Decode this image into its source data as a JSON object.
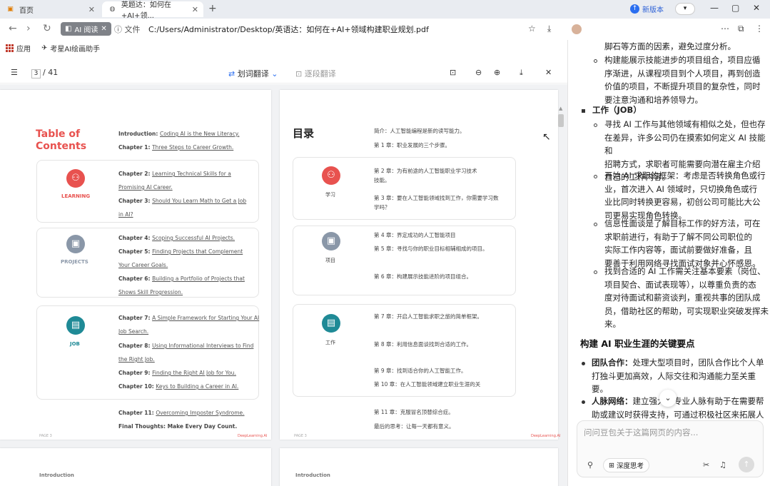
{
  "tabs": [
    {
      "label": "百页",
      "icon": "folder-icon"
    },
    {
      "label": "英题达：如何在+AI+领...",
      "icon": "globe-icon"
    }
  ],
  "chrome": {
    "new_version": "新版本",
    "profile": "▾"
  },
  "toolbar": {
    "ai_chip": "AI 阅读",
    "file_label": "文件",
    "address": "C:/Users/Administrator/Desktop/英语达：如何在+AI+领域构建职业规划.pdf"
  },
  "bookmarks": [
    {
      "label": "应用"
    },
    {
      "label": "考星AI绘画助手"
    }
  ],
  "pdf": {
    "page_current": "3",
    "page_total": "/ 41",
    "translate_label": "划词翻译",
    "translate_hint": "逐段翻译",
    "page1": {
      "title": "Table of Contents",
      "intro_prefix": "Introduction: ",
      "intro_link": "Coding AI is the New Literacy.",
      "ch1_prefix": "Chapter 1: ",
      "ch1_link": "Three Steps to Career Growth.",
      "learning_label": "LEARNING",
      "ch2_prefix": "Chapter 2: ",
      "ch2_a": "Learning Technical Skills for a",
      "ch2_b": "Promising AI Career.",
      "ch3_prefix": "Chapter 3: ",
      "ch3_a": "Should You Learn Math to Get a Job",
      "ch3_b": "in AI?",
      "projects_label": "PROJECTS",
      "ch4_prefix": "Chapter 4: ",
      "ch4_link": "Scoping Successful AI Projects.",
      "ch5_prefix": "Chapter 5: ",
      "ch5_a": "Finding Projects that Complement",
      "ch5_b": "Your Career Goals.",
      "ch6_prefix": "Chapter 6: ",
      "ch6_a": "Building a Portfolio of Projects that",
      "ch6_b": "Shows Skill Progression.",
      "job_label": "JOB",
      "ch7_prefix": "Chapter 7: ",
      "ch7_a": "A Simple Framework for Starting Your AI",
      "ch7_b": "Job Search.",
      "ch8_prefix": "Chapter 8: ",
      "ch8_a": "Using Informational Interviews to Find",
      "ch8_b": "the Right Job.",
      "ch9_prefix": "Chapter 9: ",
      "ch9_link": "Finding the Right AI Job for You.",
      "ch10_prefix": "Chapter 10: ",
      "ch10_link": "Keys to Building a Career in AI.",
      "ch11_prefix": "Chapter 11: ",
      "ch11_link": "Overcoming Imposter Syndrome.",
      "final": "Final Thoughts: Make Every Day Count.",
      "page_no": "PAGE 3",
      "brand": "DeepLearning.AI"
    },
    "page2": {
      "title": "目录",
      "intro": "简介：人工智能编程是新的读写能力。",
      "ch1": "第 1 章：职业发展的三个步骤。",
      "learning_label": "学习",
      "ch2_a": "第 2 章：为有前途的人工智能职业学习技术",
      "ch2_b": "技能。",
      "ch3_a": "第 3 章：要在人工智能领域找到工作，你需要学习数",
      "ch3_b": "学吗？",
      "projects_label": "项目",
      "ch4": "第 4 章：界定成功的人工智能项目",
      "ch5": "第 5 章：寻找与你的职业目标相辅相成的项目。",
      "ch6": "第 6 章：构建展示技能进阶的项目组合。",
      "job_label": "工作",
      "ch7": "第 7 章：开启人工智能求职之旅的简单框架。",
      "ch8": "第 8 章：利用信息面谈找到合适的工作。",
      "ch9": "第 9 章：找到适合你的人工智能工作。",
      "ch10": "第 10 章：在人工智能领域建立职业生涯的关",
      "ch11": "第 11 章：克服冒名顶替综合症。",
      "final": "最后的思考：让每一天都有意义。",
      "page_no": "PAGE 3",
      "brand": "DeepLearning.AI"
    },
    "page3_heading": "Introduction",
    "page4_heading": "Introduction"
  },
  "panel": {
    "top_line": "脚石等方面的因素，避免过度分析。",
    "b1": [
      "构建能展示技能进步的项目组合，项目应循",
      "序渐进，从课程项目到个人项目，再到创造",
      "价值的项目，不断提升项目的复杂性，同时",
      "要注意沟通和培养领导力。"
    ],
    "section_job": "工作（JOB）",
    "b2": [
      "寻找 AI 工作与其他领域有相似之处，但也存",
      "在差异，许多公司仍在摸索如何定义 AI 技能和",
      "招聘方式，求职者可能需要向潜在雇主介绍",
      "自己的工作内容。"
    ],
    "b3": [
      "开始 AI 求职的框架：考虑是否转换角色或行",
      "业，首次进入 AI 领域时，只切换角色或行",
      "业比同时转换更容易，初创公司可能比大公",
      "司更易实现角色转换。"
    ],
    "b4": [
      "信息性面谈是了解目标工作的好方法，可在",
      "求职前进行，有助于了解不同公司职位的",
      "实际工作内容等，面试前要做好准备，且",
      "要善于利用网络寻找面试对象并心怀感恩。"
    ],
    "b5": [
      "找到合适的 AI 工作需关注基本要素（岗位、",
      "项目契合、面试表现等），以尊重负责的态",
      "度对待面试和薪资谈判，重视共事的团队成",
      "员，借助社区的帮助，可实现职业突破发挥未来。"
    ],
    "heading": "构建 AI 职业生涯的关键要点",
    "k1_label": "团队合作：",
    "k1": [
      "处理大型项目时，团队合作比个人单",
      "打独斗更加高效，人际交往和沟通能力至关重",
      "要。"
    ],
    "k2_label": "人脉网络：",
    "k2": [
      "建立强大的专业人脉有助于在需要帮",
      "助或建议时获得支持，可通过积极社区来拓展人"
    ],
    "input_placeholder": "问问豆包关于这篇网页的内容...",
    "deep_label": "深度思考"
  }
}
